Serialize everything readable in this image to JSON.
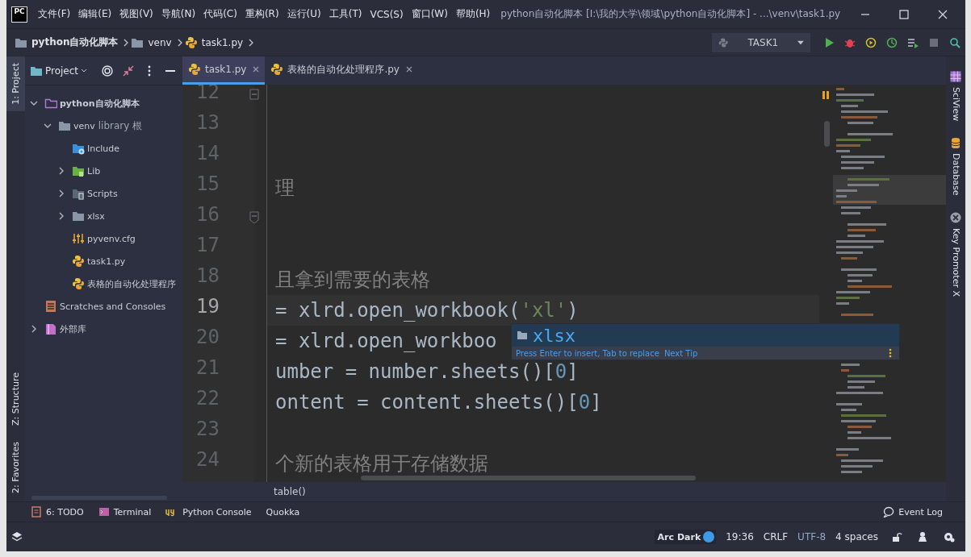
{
  "window": {
    "logo": "PC",
    "title": "python自动化脚本 [I:\\我的大学\\领域\\python自动化脚本] - ...\\venv\\task1.py"
  },
  "menu": [
    "文件(F)",
    "编辑(E)",
    "视图(V)",
    "导航(N)",
    "代码(C)",
    "重构(R)",
    "运行(U)",
    "工具(T)",
    "VCS(S)",
    "窗口(W)",
    "帮助(H)"
  ],
  "breadcrumb": [
    {
      "label": "python自动化脚本",
      "kind": "folder",
      "bold": true
    },
    {
      "label": "venv",
      "kind": "folder",
      "bold": false
    },
    {
      "label": "task1.py",
      "kind": "python",
      "bold": false
    }
  ],
  "run_config": {
    "label": "TASK1"
  },
  "left_stripe_top": [
    {
      "label": "1: Project",
      "selected": true
    }
  ],
  "left_stripe_bottom": [
    {
      "label": "Z: Structure",
      "selected": false
    },
    {
      "label": "2: Favorites",
      "selected": false
    }
  ],
  "right_stripe": [
    {
      "label": "SciView",
      "kind": "grid"
    },
    {
      "label": "Database",
      "kind": "database"
    },
    {
      "label": "Key Promoter X",
      "kind": "promoter"
    }
  ],
  "project_panel": {
    "title": "Project",
    "tree": [
      {
        "label": "python自动化脚本",
        "kind": "project",
        "expanded": true,
        "children": [
          {
            "label": "venv",
            "suffix": "library 根",
            "kind": "folder",
            "expanded": true,
            "children": [
              {
                "label": "Include",
                "kind": "include"
              },
              {
                "label": "Lib",
                "kind": "lib",
                "expanded": false
              },
              {
                "label": "Scripts",
                "kind": "scripts",
                "expanded": false
              },
              {
                "label": "xlsx",
                "kind": "plainfolder",
                "expanded": false
              },
              {
                "label": "pyvenv.cfg",
                "kind": "config"
              },
              {
                "label": "task1.py",
                "kind": "python"
              },
              {
                "label": "表格的自动化处理程序",
                "kind": "python"
              }
            ]
          }
        ]
      },
      {
        "label": "Scratches and Consoles",
        "kind": "scratches"
      },
      {
        "label": "外部库",
        "kind": "library",
        "expanded": false
      }
    ]
  },
  "tabs": [
    {
      "label": "task1.py",
      "selected": true
    },
    {
      "label": "表格的自动化处理程序.py",
      "selected": false
    }
  ],
  "editor": {
    "lines": [
      {
        "number": "12",
        "current": false
      },
      {
        "number": "13",
        "current": false
      },
      {
        "number": "14",
        "current": false
      },
      {
        "number": "15",
        "current": false,
        "tokens": [
          {
            "text": "理",
            "kind": "comment"
          }
        ]
      },
      {
        "number": "16",
        "current": false
      },
      {
        "number": "17",
        "current": false
      },
      {
        "number": "18",
        "current": false,
        "tokens": [
          {
            "text": "且拿到需要的表格",
            "kind": "comment"
          }
        ]
      },
      {
        "number": "19",
        "current": true,
        "tokens": [
          {
            "text": "= xlrd.open_workbook(",
            "kind": "plain"
          },
          {
            "text": "'xl'",
            "kind": "string"
          },
          {
            "text": ")",
            "kind": "plain"
          }
        ]
      },
      {
        "number": "20",
        "current": false,
        "tokens": [
          {
            "text": "= xlrd.open_workboo",
            "kind": "plain"
          }
        ]
      },
      {
        "number": "21",
        "current": false,
        "tokens": [
          {
            "text": "umber = number.sheets()[",
            "kind": "plain"
          },
          {
            "text": "0",
            "kind": "number"
          },
          {
            "text": "]",
            "kind": "plain"
          }
        ]
      },
      {
        "number": "22",
        "current": false,
        "tokens": [
          {
            "text": "ontent = content.sheets()[",
            "kind": "plain"
          },
          {
            "text": "0",
            "kind": "number"
          },
          {
            "text": "]",
            "kind": "plain"
          }
        ]
      },
      {
        "number": "23",
        "current": false
      },
      {
        "number": "24",
        "current": false,
        "tokens": [
          {
            "text": "个新的表格用于存储数据",
            "kind": "comment"
          }
        ]
      }
    ],
    "breadcrumb": "table()",
    "completion": {
      "item": "xlsx",
      "hint": "Press Enter to insert, Tab to replace",
      "link": "Next Tip"
    }
  },
  "tool_windows": [
    {
      "label": "6: TODO",
      "kind": "todo"
    },
    {
      "label": "Terminal",
      "kind": "terminal"
    },
    {
      "label": "Python Console",
      "kind": "console"
    },
    {
      "label": "Quokka",
      "kind": "none"
    }
  ],
  "event_log": "Event Log",
  "status_bar": {
    "theme": "Arc Dark",
    "position": "19:36",
    "line_separator": "CRLF",
    "encoding": "UTF-8",
    "indent": "4 spaces"
  }
}
